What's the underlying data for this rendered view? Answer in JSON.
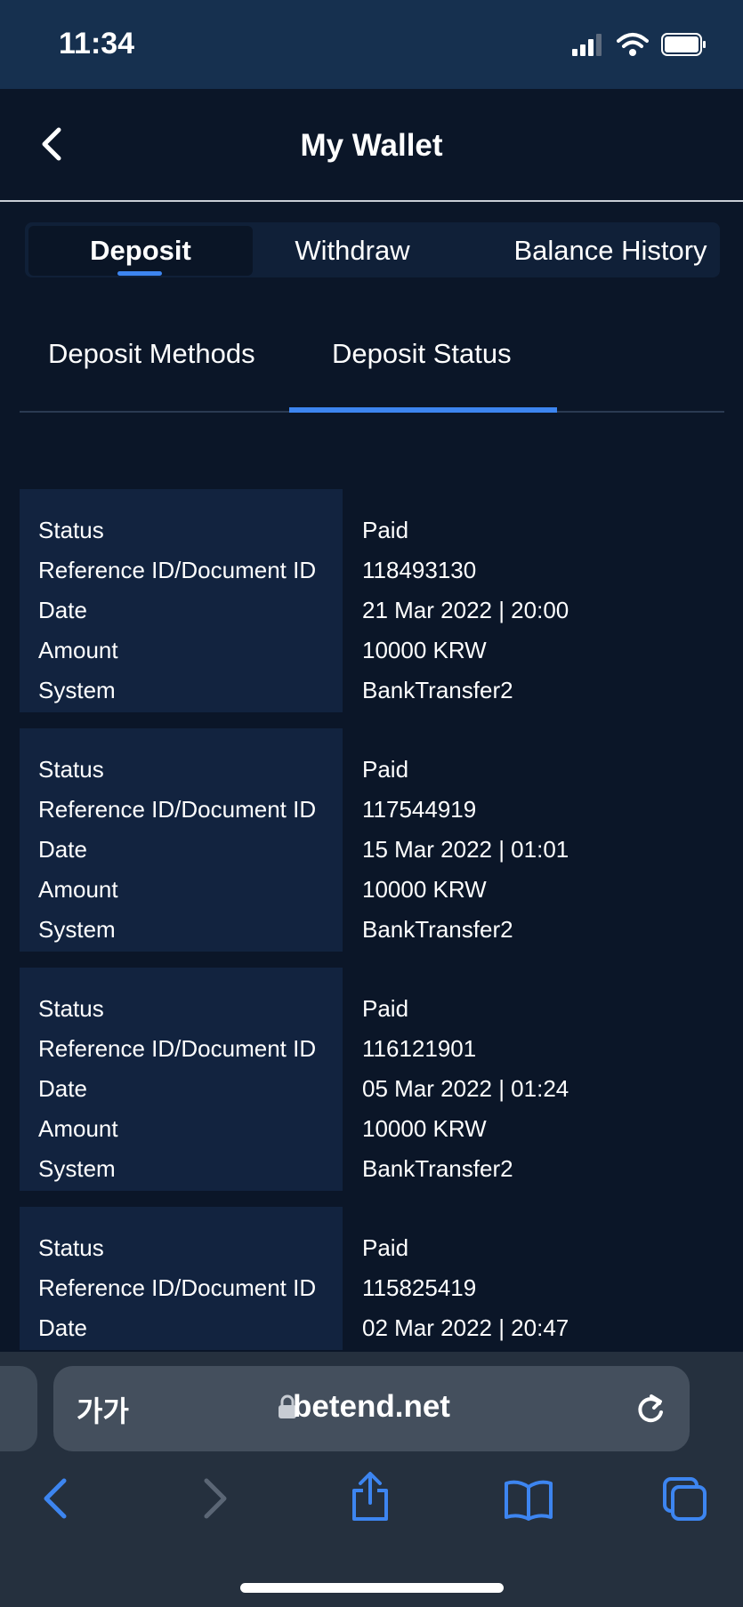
{
  "status_bar": {
    "time": "11:34"
  },
  "header": {
    "title": "My Wallet"
  },
  "main_tabs": [
    "Deposit",
    "Withdraw",
    "Balance History"
  ],
  "sub_tabs": [
    "Deposit Methods",
    "Deposit Status"
  ],
  "labels": [
    "Status",
    "Reference ID/Document ID",
    "Date",
    "Amount",
    "System"
  ],
  "records": [
    {
      "status": "Paid",
      "ref": "118493130",
      "date": "21 Mar 2022 | 20:00",
      "amount": "10000 KRW",
      "system": "BankTransfer2"
    },
    {
      "status": "Paid",
      "ref": "117544919",
      "date": "15 Mar 2022 | 01:01",
      "amount": "10000 KRW",
      "system": "BankTransfer2"
    },
    {
      "status": "Paid",
      "ref": "116121901",
      "date": "05 Mar 2022 | 01:24",
      "amount": "10000 KRW",
      "system": "BankTransfer2"
    },
    {
      "status": "Paid",
      "ref": "115825419",
      "date": "02 Mar 2022 | 20:47"
    }
  ],
  "browser": {
    "text_size_label": "가가",
    "url": "betend.net"
  },
  "colors": {
    "accent": "#3d85f0",
    "background": "#0b1628",
    "card": "#12233f"
  }
}
